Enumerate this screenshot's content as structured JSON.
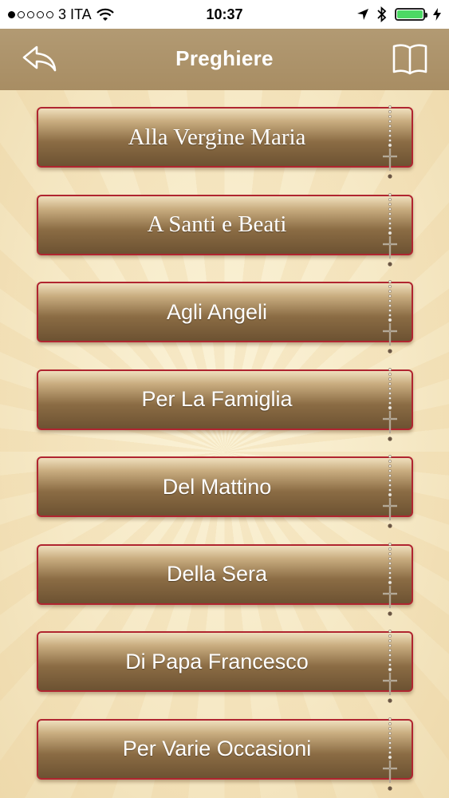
{
  "status_bar": {
    "signal_filled": 1,
    "signal_total": 5,
    "carrier": "3 ITA",
    "time": "10:37",
    "icons": [
      "wifi-icon",
      "location-arrow-icon",
      "bluetooth-icon",
      "battery-icon",
      "charging-bolt-icon"
    ],
    "battery_color": "#4cd964"
  },
  "nav": {
    "title": "Preghiere",
    "left_icon": "back-arrow-icon",
    "right_icon": "book-icon"
  },
  "prayers": [
    {
      "label": "Alla Vergine Maria",
      "icon": "rosary-icon"
    },
    {
      "label": "A Santi e Beati",
      "icon": "rosary-icon"
    },
    {
      "label": "Agli Angeli",
      "icon": "rosary-icon"
    },
    {
      "label": "Per La Famiglia",
      "icon": "rosary-icon"
    },
    {
      "label": "Del Mattino",
      "icon": "rosary-icon"
    },
    {
      "label": "Della Sera",
      "icon": "rosary-icon"
    },
    {
      "label": "Di Papa Francesco",
      "icon": "rosary-icon"
    },
    {
      "label": "Per Varie Occasioni",
      "icon": "rosary-icon"
    }
  ],
  "colors": {
    "nav_background": "#a88d63",
    "button_border": "#b02530",
    "button_dark": "#6d5232"
  }
}
